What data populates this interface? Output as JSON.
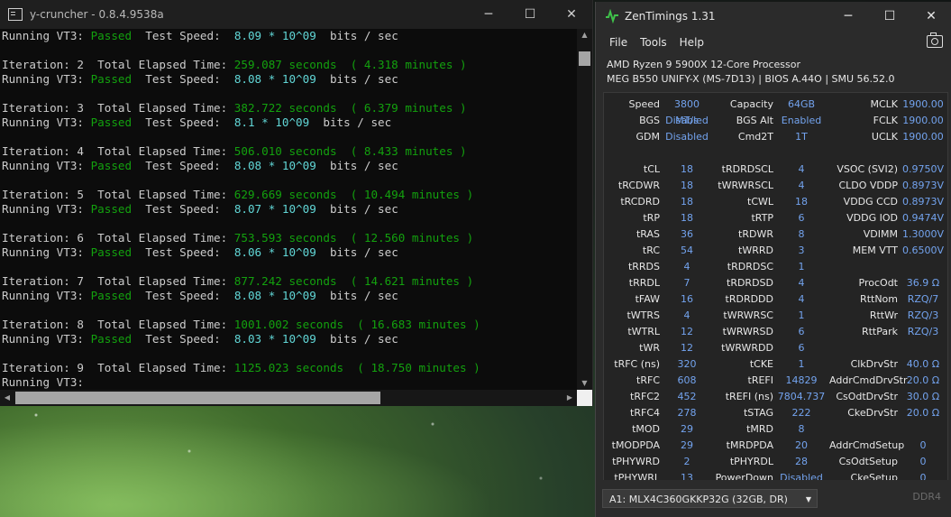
{
  "console": {
    "title": "y-cruncher - 0.8.4.9538a",
    "lines": [
      [
        {
          "t": "Running VT3: ",
          "c": ""
        },
        {
          "t": "Passed",
          "c": "g"
        },
        {
          "t": "  Test Speed:  ",
          "c": ""
        },
        {
          "t": "8.09 * 10^09",
          "c": "c"
        },
        {
          "t": "  bits / sec",
          "c": ""
        }
      ],
      [],
      [
        {
          "t": "Iteration: 2  Total Elapsed Time: ",
          "c": ""
        },
        {
          "t": "259.087 seconds  ( 4.318 minutes )",
          "c": "g"
        }
      ],
      [
        {
          "t": "Running VT3: ",
          "c": ""
        },
        {
          "t": "Passed",
          "c": "g"
        },
        {
          "t": "  Test Speed:  ",
          "c": ""
        },
        {
          "t": "8.08 * 10^09",
          "c": "c"
        },
        {
          "t": "  bits / sec",
          "c": ""
        }
      ],
      [],
      [
        {
          "t": "Iteration: 3  Total Elapsed Time: ",
          "c": ""
        },
        {
          "t": "382.722 seconds  ( 6.379 minutes )",
          "c": "g"
        }
      ],
      [
        {
          "t": "Running VT3: ",
          "c": ""
        },
        {
          "t": "Passed",
          "c": "g"
        },
        {
          "t": "  Test Speed:  ",
          "c": ""
        },
        {
          "t": "8.1 * 10^09",
          "c": "c"
        },
        {
          "t": "  bits / sec",
          "c": ""
        }
      ],
      [],
      [
        {
          "t": "Iteration: 4  Total Elapsed Time: ",
          "c": ""
        },
        {
          "t": "506.010 seconds  ( 8.433 minutes )",
          "c": "g"
        }
      ],
      [
        {
          "t": "Running VT3: ",
          "c": ""
        },
        {
          "t": "Passed",
          "c": "g"
        },
        {
          "t": "  Test Speed:  ",
          "c": ""
        },
        {
          "t": "8.08 * 10^09",
          "c": "c"
        },
        {
          "t": "  bits / sec",
          "c": ""
        }
      ],
      [],
      [
        {
          "t": "Iteration: 5  Total Elapsed Time: ",
          "c": ""
        },
        {
          "t": "629.669 seconds  ( 10.494 minutes )",
          "c": "g"
        }
      ],
      [
        {
          "t": "Running VT3: ",
          "c": ""
        },
        {
          "t": "Passed",
          "c": "g"
        },
        {
          "t": "  Test Speed:  ",
          "c": ""
        },
        {
          "t": "8.07 * 10^09",
          "c": "c"
        },
        {
          "t": "  bits / sec",
          "c": ""
        }
      ],
      [],
      [
        {
          "t": "Iteration: 6  Total Elapsed Time: ",
          "c": ""
        },
        {
          "t": "753.593 seconds  ( 12.560 minutes )",
          "c": "g"
        }
      ],
      [
        {
          "t": "Running VT3: ",
          "c": ""
        },
        {
          "t": "Passed",
          "c": "g"
        },
        {
          "t": "  Test Speed:  ",
          "c": ""
        },
        {
          "t": "8.06 * 10^09",
          "c": "c"
        },
        {
          "t": "  bits / sec",
          "c": ""
        }
      ],
      [],
      [
        {
          "t": "Iteration: 7  Total Elapsed Time: ",
          "c": ""
        },
        {
          "t": "877.242 seconds  ( 14.621 minutes )",
          "c": "g"
        }
      ],
      [
        {
          "t": "Running VT3: ",
          "c": ""
        },
        {
          "t": "Passed",
          "c": "g"
        },
        {
          "t": "  Test Speed:  ",
          "c": ""
        },
        {
          "t": "8.08 * 10^09",
          "c": "c"
        },
        {
          "t": "  bits / sec",
          "c": ""
        }
      ],
      [],
      [
        {
          "t": "Iteration: 8  Total Elapsed Time: ",
          "c": ""
        },
        {
          "t": "1001.002 seconds  ( 16.683 minutes )",
          "c": "g"
        }
      ],
      [
        {
          "t": "Running VT3: ",
          "c": ""
        },
        {
          "t": "Passed",
          "c": "g"
        },
        {
          "t": "  Test Speed:  ",
          "c": ""
        },
        {
          "t": "8.03 * 10^09",
          "c": "c"
        },
        {
          "t": "  bits / sec",
          "c": ""
        }
      ],
      [],
      [
        {
          "t": "Iteration: 9  Total Elapsed Time: ",
          "c": ""
        },
        {
          "t": "1125.023 seconds  ( 18.750 minutes )",
          "c": "g"
        }
      ],
      [
        {
          "t": "Running VT3:",
          "c": ""
        }
      ]
    ]
  },
  "zen": {
    "title": "ZenTimings 1.31",
    "menu": [
      "File",
      "Tools",
      "Help"
    ],
    "cpu": "AMD Ryzen 9 5900X 12-Core Processor",
    "board": "MEG B550 UNIFY-X (MS-7D13) | BIOS A.44O | SMU 56.52.0",
    "col1": [
      [
        "Speed",
        "3800 MT/s"
      ],
      [
        "BGS",
        "Disabled"
      ],
      [
        "GDM",
        "Disabled"
      ],
      [],
      [
        "tCL",
        "18"
      ],
      [
        "tRCDWR",
        "18"
      ],
      [
        "tRCDRD",
        "18"
      ],
      [
        "tRP",
        "18"
      ],
      [
        "tRAS",
        "36"
      ],
      [
        "tRC",
        "54"
      ],
      [
        "tRRDS",
        "4"
      ],
      [
        "tRRDL",
        "7"
      ],
      [
        "tFAW",
        "16"
      ],
      [
        "tWTRS",
        "4"
      ],
      [
        "tWTRL",
        "12"
      ],
      [
        "tWR",
        "12"
      ],
      [
        "tRFC (ns)",
        "320"
      ],
      [
        "tRFC",
        "608"
      ],
      [
        "tRFC2",
        "452"
      ],
      [
        "tRFC4",
        "278"
      ],
      [
        "tMOD",
        "29"
      ],
      [
        "tMODPDA",
        "29"
      ],
      [
        "tPHYWRD",
        "2"
      ],
      [
        "tPHYWRL",
        "13"
      ]
    ],
    "col2": [
      [
        "Capacity",
        "64GB"
      ],
      [
        "BGS Alt",
        "Enabled"
      ],
      [
        "Cmd2T",
        "1T"
      ],
      [],
      [
        "tRDRDSCL",
        "4"
      ],
      [
        "tWRWRSCL",
        "4"
      ],
      [
        "tCWL",
        "18"
      ],
      [
        "tRTP",
        "6"
      ],
      [
        "tRDWR",
        "8"
      ],
      [
        "tWRRD",
        "3"
      ],
      [
        "tRDRDSC",
        "1"
      ],
      [
        "tRDRDSD",
        "4"
      ],
      [
        "tRDRDDD",
        "4"
      ],
      [
        "tWRWRSC",
        "1"
      ],
      [
        "tWRWRSD",
        "6"
      ],
      [
        "tWRWRDD",
        "6"
      ],
      [
        "tCKE",
        "1"
      ],
      [
        "tREFI",
        "14829"
      ],
      [
        "tREFI (ns)",
        "7804.737"
      ],
      [
        "tSTAG",
        "222"
      ],
      [
        "tMRD",
        "8"
      ],
      [
        "tMRDPDA",
        "20"
      ],
      [
        "tPHYRDL",
        "28"
      ],
      [
        "PowerDown",
        "Disabled"
      ]
    ],
    "col3": [
      [
        "MCLK",
        "1900.00"
      ],
      [
        "FCLK",
        "1900.00"
      ],
      [
        "UCLK",
        "1900.00"
      ],
      [],
      [
        "VSOC (SVI2)",
        "0.9750V"
      ],
      [
        "CLDO VDDP",
        "0.8973V"
      ],
      [
        "VDDG CCD",
        "0.8973V"
      ],
      [
        "VDDG IOD",
        "0.9474V"
      ],
      [
        "VDIMM",
        "1.3000V"
      ],
      [
        "MEM VTT",
        "0.6500V"
      ],
      [],
      [
        "ProcOdt",
        "36.9 Ω"
      ],
      [
        "RttNom",
        "RZQ/7"
      ],
      [
        "RttWr",
        "RZQ/3"
      ],
      [
        "RttPark",
        "RZQ/3"
      ],
      [],
      [
        "ClkDrvStr",
        "40.0 Ω"
      ],
      [
        "AddrCmdDrvStr",
        "20.0 Ω"
      ],
      [
        "CsOdtDrvStr",
        "30.0 Ω"
      ],
      [
        "CkeDrvStr",
        "20.0 Ω"
      ],
      [],
      [
        "AddrCmdSetup",
        "0"
      ],
      [
        "CsOdtSetup",
        "0"
      ],
      [
        "CkeSetup",
        "0"
      ]
    ],
    "dimm": "A1: MLX4C360GKKP32G (32GB, DR)",
    "ddr": "DDR4"
  }
}
